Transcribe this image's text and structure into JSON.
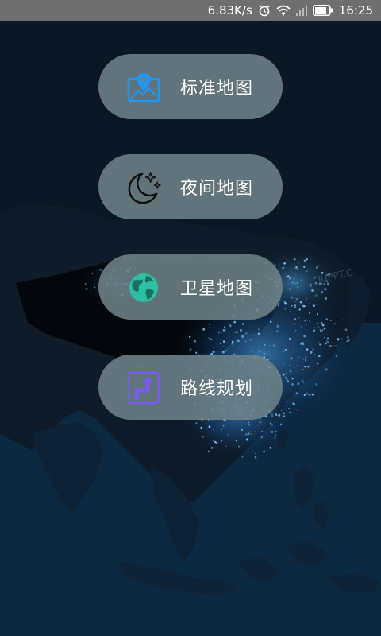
{
  "status_bar": {
    "speed": "6.83K/s",
    "time": "16:25",
    "icons": [
      "alarm-icon",
      "wifi-icon",
      "signal-icon",
      "battery-icon"
    ]
  },
  "menu": {
    "items": [
      {
        "label": "标准地图",
        "icon": "map-pin-image-icon",
        "icon_color": "#2196f3"
      },
      {
        "label": "夜间地图",
        "icon": "crescent-moon-stars-icon",
        "icon_color": "#111111"
      },
      {
        "label": "卫星地图",
        "icon": "globe-icon",
        "icon_color": "#2bbfa6"
      },
      {
        "label": "路线规划",
        "icon": "route-turn-arrow-icon",
        "icon_color": "#7b5cf0"
      }
    ]
  },
  "colors": {
    "status_bar_bg": "#6f6f6f",
    "button_bg": "#6e8287",
    "background": "#0c1a28",
    "city_lights": "#3aa0ff"
  }
}
